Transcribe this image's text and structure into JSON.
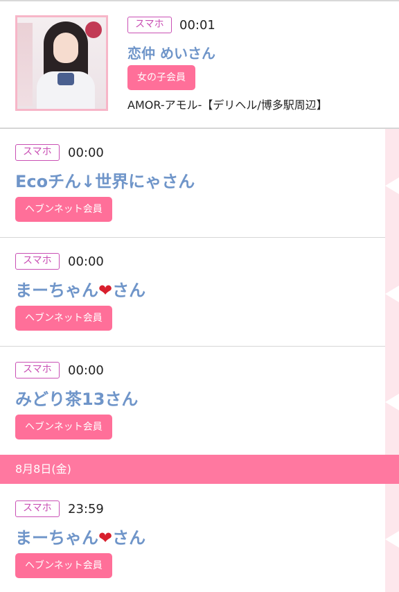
{
  "entries": [
    {
      "device": "スマホ",
      "time": "00:01",
      "name": "恋仲 めいさん",
      "member_type": "女の子会員",
      "shop": "AMOR-アモル-【デリヘル/博多駅周辺】"
    },
    {
      "device": "スマホ",
      "time": "00:00",
      "name": "Ecoチん↓世界にゃさん",
      "member_type": "ヘブンネット会員"
    },
    {
      "device": "スマホ",
      "time": "00:00",
      "name_before": "まーちゃん",
      "name_heart": "❤",
      "name_after": "さん",
      "member_type": "ヘブンネット会員"
    },
    {
      "device": "スマホ",
      "time": "00:00",
      "name": "みどり茶13さん",
      "member_type": "ヘブンネット会員"
    },
    {
      "device": "スマホ",
      "time": "23:59",
      "name_before": "まーちゃん",
      "name_heart": "❤",
      "name_after": "さん",
      "member_type": "ヘブンネット会員"
    }
  ],
  "date_header": "8月8日(金)",
  "colors": {
    "name": "#6f95c9",
    "member_button": "#ff6f99",
    "device_chip": "#c94fb4",
    "date_bar": "#ff78a0",
    "rail": "#fde7ec"
  }
}
